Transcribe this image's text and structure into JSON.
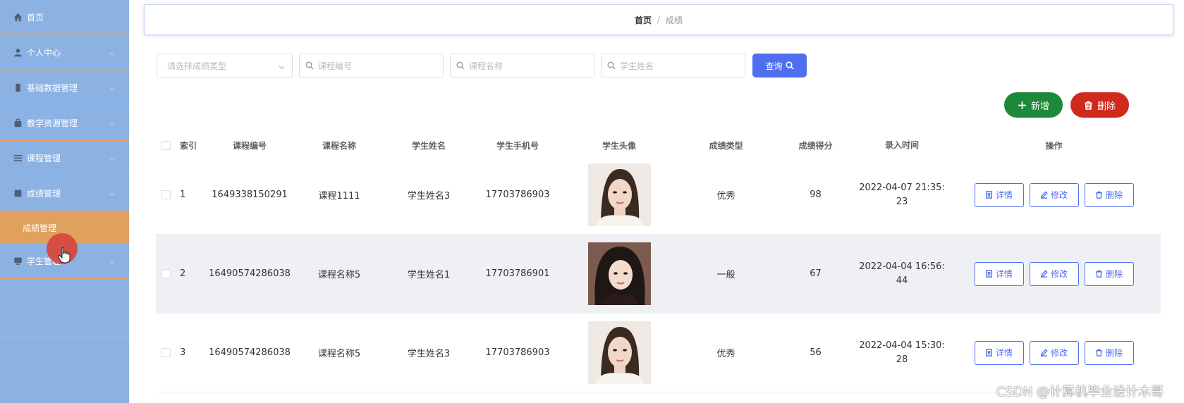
{
  "sidebar": {
    "items": [
      {
        "label": "首页",
        "icon": "home-icon"
      },
      {
        "label": "个人中心",
        "icon": "user-icon"
      },
      {
        "label": "基础数据管理",
        "icon": "phone-icon"
      },
      {
        "label": "教学资源管理",
        "icon": "bag-icon"
      },
      {
        "label": "课程管理",
        "icon": "list-icon"
      },
      {
        "label": "成绩管理",
        "icon": "report-icon"
      }
    ],
    "active_sub": "成绩管理",
    "student_item": {
      "label": "学生管理",
      "icon": "monitor-icon"
    }
  },
  "breadcrumb": {
    "home": "首页",
    "separator": "/",
    "current": "成绩"
  },
  "search": {
    "type_placeholder": "请选择成绩类型",
    "course_code_placeholder": "课程编号",
    "course_name_placeholder": "课程名称",
    "student_name_placeholder": "学生姓名",
    "query_label": "查询"
  },
  "actions": {
    "add_label": "新增",
    "delete_label": "删除"
  },
  "table": {
    "headers": [
      "索引",
      "课程编号",
      "课程名称",
      "学生姓名",
      "学生手机号",
      "学生头像",
      "成绩类型",
      "成绩得分",
      "录入时间",
      "操作"
    ],
    "rows": [
      {
        "index": "1",
        "code": "1649338150291",
        "name": "课程1111",
        "student": "学生姓名3",
        "phone": "17703786903",
        "type": "优秀",
        "score": "98",
        "time_a": "2022-04-07 21:35:",
        "time_b": "23"
      },
      {
        "index": "2",
        "code": "16490574286038",
        "name": "课程名称5",
        "student": "学生姓名1",
        "phone": "17703786901",
        "type": "一般",
        "score": "67",
        "time_a": "2022-04-04 16:56:",
        "time_b": "44"
      },
      {
        "index": "3",
        "code": "16490574286038",
        "name": "课程名称5",
        "student": "学生姓名3",
        "phone": "17703786903",
        "type": "优秀",
        "score": "56",
        "time_a": "2022-04-04 15:30:",
        "time_b": "28"
      }
    ],
    "ops": {
      "detail": "详情",
      "edit": "修改",
      "delete": "删除"
    }
  },
  "watermark": "CSDN @计算机毕业设计木哥",
  "colors": {
    "sidebar": "#8cb2e3",
    "accent": "#4f6ff0",
    "add": "#1c8a3a",
    "danger": "#cf2a1c",
    "active_sub": "#e0a15e"
  }
}
